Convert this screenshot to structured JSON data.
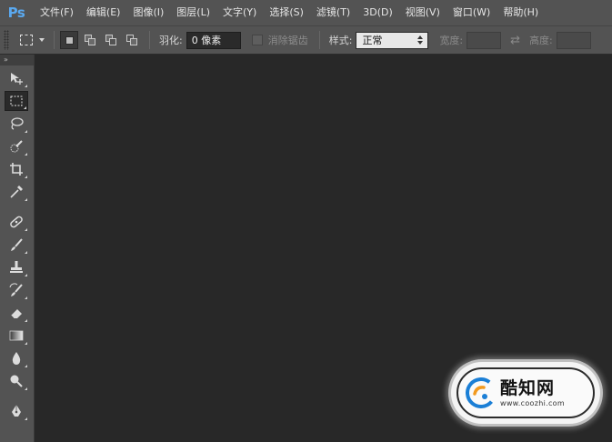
{
  "app": {
    "logo": "Ps"
  },
  "menu": [
    "文件(F)",
    "编辑(E)",
    "图像(I)",
    "图层(L)",
    "文字(Y)",
    "选择(S)",
    "滤镜(T)",
    "3D(D)",
    "视图(V)",
    "窗口(W)",
    "帮助(H)"
  ],
  "options": {
    "feather_label": "羽化:",
    "feather_value": "0 像素",
    "antialias_label": "消除锯齿",
    "style_label": "样式:",
    "style_value": "正常",
    "width_label": "宽度:",
    "height_label": "高度:"
  },
  "toolbar": {
    "collapse_glyph": "»",
    "tools": [
      "move-tool",
      "rectangular-marquee-tool",
      "lasso-tool",
      "quick-selection-tool",
      "crop-tool",
      "eyedropper-tool",
      "spot-healing-brush-tool",
      "brush-tool",
      "clone-stamp-tool",
      "history-brush-tool",
      "eraser-tool",
      "gradient-tool",
      "blur-tool",
      "dodge-tool",
      "pen-tool"
    ],
    "active_tool": "rectangular-marquee-tool"
  },
  "watermark": {
    "title": "酷知网",
    "url": "www.coozhi.com"
  },
  "colors": {
    "accent": "#5aa9f0",
    "panel": "#535353",
    "canvas": "#282828"
  }
}
